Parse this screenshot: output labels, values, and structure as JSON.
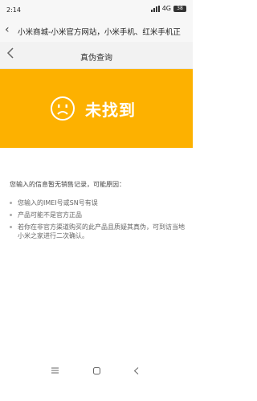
{
  "status_bar": {
    "time": "2:14",
    "network": "4G",
    "battery": "38",
    "signal_icon": "signal-icon",
    "battery_icon": "battery-icon"
  },
  "browser": {
    "back_icon": "chevron-left-icon",
    "url_title": "小米商城-小米官方网站，小米手机、红米手机正"
  },
  "header": {
    "back_icon": "chevron-left-icon",
    "title": "真伪查询"
  },
  "result": {
    "icon": "sad-face-icon",
    "title": "未找到",
    "banner_color": "#fdb100"
  },
  "reasons": {
    "intro": "您输入的信息暂无销售记录，可能原因：",
    "items": [
      "您输入的IMEI号或SN号有误",
      "产品可能不是官方正品",
      "若你在非官方渠道购买的此产品且质疑其真伪，可到访当地小米之家进行二次确认。"
    ]
  },
  "system_nav": {
    "menu_icon": "menu-icon",
    "home_icon": "home-icon",
    "back_icon": "back-icon"
  }
}
